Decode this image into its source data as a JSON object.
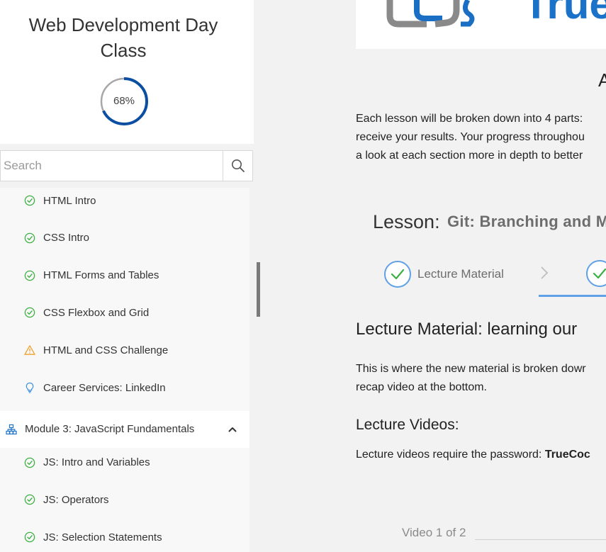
{
  "course": {
    "title_line1": "Web Development Day",
    "title_line2": "Class",
    "progress": 0.68,
    "progress_label": "68%",
    "progress_color": "#0b4ea2",
    "progress_track_color": "#a8a8a8"
  },
  "search": {
    "placeholder": "Search",
    "value": "",
    "icon": "search-icon"
  },
  "lessons_before": [
    {
      "label": "HTML Intro",
      "icon": "check-circle-icon",
      "status": "complete"
    },
    {
      "label": "CSS Intro",
      "icon": "check-circle-icon",
      "status": "complete"
    },
    {
      "label": "HTML Forms and Tables",
      "icon": "check-circle-icon",
      "status": "complete"
    },
    {
      "label": "CSS Flexbox and Grid",
      "icon": "check-circle-icon",
      "status": "complete"
    },
    {
      "label": "HTML and CSS Challenge",
      "icon": "warning-triangle-icon",
      "status": "warning"
    },
    {
      "label": "Career Services: LinkedIn",
      "icon": "lightbulb-icon",
      "status": "info"
    }
  ],
  "module": {
    "label": "Module 3: JavaScript Fundamentals",
    "icon": "module-tree-icon",
    "expanded": true,
    "toggle_icon": "chevron-up-icon"
  },
  "lessons_after": [
    {
      "label": "JS: Intro and Variables",
      "icon": "check-circle-icon",
      "status": "complete"
    },
    {
      "label": "JS: Operators",
      "icon": "check-circle-icon",
      "status": "complete"
    },
    {
      "label": "JS: Selection Statements",
      "icon": "check-circle-icon",
      "status": "complete"
    }
  ],
  "colors": {
    "complete": "#3cb043",
    "warning": "#f0a02a",
    "info": "#3a8fe0",
    "module_icon": "#1a73c9",
    "step_accent": "#5fa0e6"
  },
  "main": {
    "logo_text": "True",
    "section_heading": "A",
    "intro_lines": [
      "Each lesson will be broken down into 4 parts:",
      "receive your results. Your progress throughou",
      "a look at each section more in depth to better"
    ],
    "lesson_label": "Lesson:",
    "lesson_name": "Git: Branching and M",
    "step1_label": "Lecture Material",
    "step_separator_icon": "chevron-right-icon",
    "lecture_title": "Lecture Material: learning our",
    "lecture_lines": [
      "This is where the new material is broken dowr",
      "recap video at the bottom."
    ],
    "videos_heading": "Lecture Videos:",
    "password_prefix": "Lecture videos require the password: ",
    "password_value": "TrueCoc",
    "video_counter": "Video 1 of 2"
  }
}
